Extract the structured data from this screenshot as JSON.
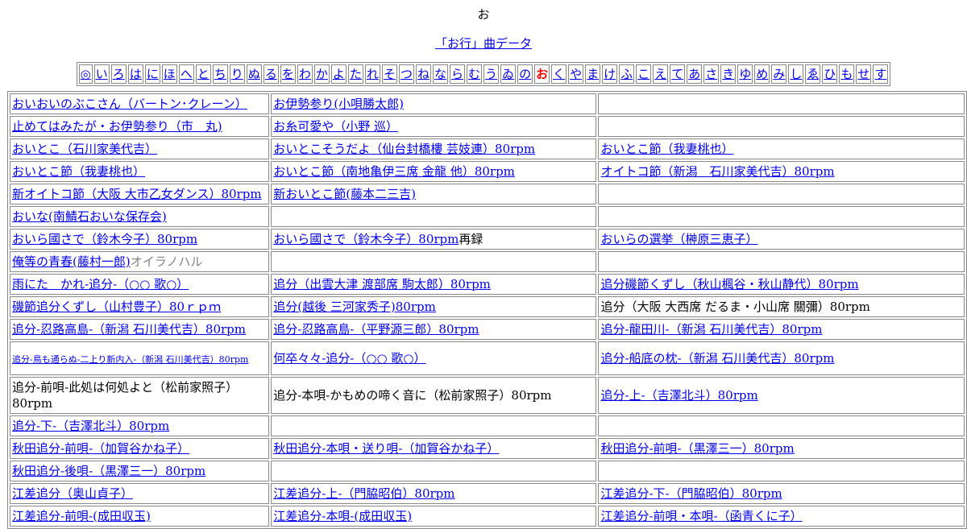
{
  "header": {
    "title": "お",
    "sublink": "「お行」曲データ"
  },
  "kana_nav": [
    "◎",
    "い",
    "ろ",
    "は",
    "に",
    "ほ",
    "へ",
    "と",
    "ち",
    "り",
    "ぬ",
    "る",
    "を",
    "わ",
    "か",
    "よ",
    "た",
    "れ",
    "そ",
    "つ",
    "ね",
    "な",
    "ら",
    "む",
    "う",
    "ゐ",
    "の",
    "お",
    "く",
    "や",
    "ま",
    "け",
    "ふ",
    "こ",
    "え",
    "て",
    "あ",
    "さ",
    "き",
    "ゆ",
    "め",
    "み",
    "し",
    "ゑ",
    "ひ",
    "も",
    "せ",
    "す"
  ],
  "kana_current": "お",
  "rows": [
    [
      {
        "link": "おいおいのぶこさん（バートン･クレーン）"
      },
      {
        "link": "お伊勢参り(小唄勝太郎)"
      },
      {}
    ],
    [
      {
        "link": "止めてはみたが・お伊勢参り（市　丸)"
      },
      {
        "link": "お糸可愛や（小野 巡）"
      },
      {}
    ],
    [
      {
        "link": "おいとこ（石川家美代吉）"
      },
      {
        "link": "おいとこそうだよ（仙台封橋樓 芸妓連）80rpm"
      },
      {
        "link": "おいとこ節（我妻桃也）"
      }
    ],
    [
      {
        "link": "おいとこ節（我妻桃也）"
      },
      {
        "link": "おいとこ節（南地亀伊三席 金龍 他）80rpm"
      },
      {
        "link": "オイトコ節（新潟　石川家美代吉）80rpm"
      }
    ],
    [
      {
        "link": "新オイトコ節（大阪 大市乙女ダンス）80rpm"
      },
      {
        "link": "新おいとこ節(藤本二三吉)"
      },
      {}
    ],
    [
      {
        "link": "おいな(南鯖石おいな保存会)"
      },
      {},
      {}
    ],
    [
      {
        "link": "おいら國さで（鈴木今子）80rpm"
      },
      {
        "link": "おいら國さで（鈴木今子）80rpm",
        "text": "再録"
      },
      {
        "link": "おいらの選挙（榊原三恵子）"
      }
    ],
    [
      {
        "link": "俺等の青春(藤村一郎)",
        "gray": "オイラノハル"
      },
      {},
      {}
    ],
    [
      {
        "link": "雨にた　かれ-追分-（○○ 歌○）"
      },
      {
        "link": "追分（出雲大津 渡部席 駒太郎）80rpm"
      },
      {
        "link": "追分磯節くずし（秋山楓谷・秋山静代）80rpm"
      }
    ],
    [
      {
        "link": "磯節追分くずし（山村豊子）80ｒｐｍ"
      },
      {
        "link": "追分(越後 三河家秀子)80rpm"
      },
      {
        "text": "追分（大阪 大西席 だるま・小山席 關彌）80rpm"
      }
    ],
    [
      {
        "link": "追分-忍路高島-（新潟 石川美代吉）80rpm"
      },
      {
        "link": "追分-忍路高島-（平野源三郎）80rpm"
      },
      {
        "link": "追分-龍田川-（新潟 石川美代吉）80rpm"
      }
    ],
    [
      {
        "small": "追分-鳥も通らぬ-二上り新内入-（新潟 石川美代吉）80rpm"
      },
      {
        "link": "何卒々々-追分-（○○ 歌○）"
      },
      {
        "link": "追分-船底の枕-（新潟 石川美代吉）80rpm"
      }
    ],
    [
      {
        "text": "追分-前唄-此処は何処よと（松前家照子）80rpm"
      },
      {
        "text": "追分-本唄-かもめの啼く音に（松前家照子）80rpm"
      },
      {
        "link": "追分-上-（吉澤北斗）80rpm"
      }
    ],
    [
      {
        "link": "追分-下-（吉澤北斗）80rpm"
      },
      {},
      {}
    ],
    [
      {
        "link": "秋田追分-前唄-（加賀谷かね子）"
      },
      {
        "link": "秋田追分-本唄・送り唄-（加賀谷かね子）"
      },
      {
        "link": "秋田追分-前唄-（黒澤三一）80rpm"
      }
    ],
    [
      {
        "link": "秋田追分-後唄-（黒澤三一）80rpm"
      },
      {},
      {}
    ],
    [
      {
        "link": "江差追分（奥山貞子）"
      },
      {
        "link": "江差追分-上-（門脇昭伯）80rpm"
      },
      {
        "link": "江差追分-下-（門脇昭伯）80rpm"
      }
    ],
    [
      {
        "link": "江差追分-前唄-(成田収玉)"
      },
      {
        "link": "江差追分-本唄-(成田収玉)"
      },
      {
        "link": "江差追分-前唄・本唄-（函青くに子）"
      }
    ]
  ]
}
